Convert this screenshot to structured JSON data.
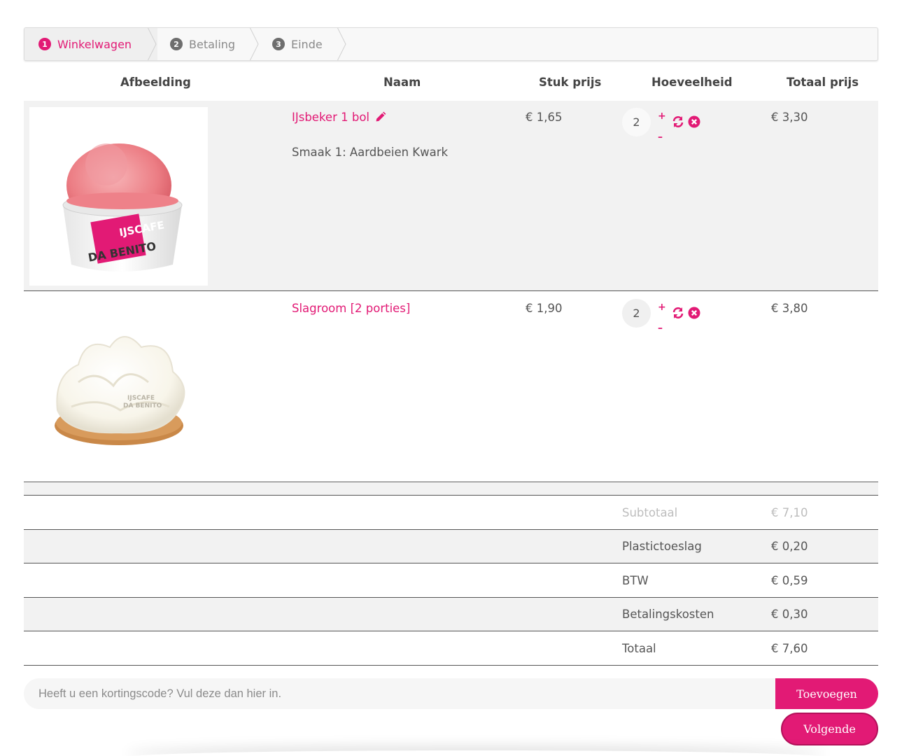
{
  "steps": [
    {
      "num": "1",
      "label": "Winkelwagen",
      "active": true
    },
    {
      "num": "2",
      "label": "Betaling",
      "active": false
    },
    {
      "num": "3",
      "label": "Einde",
      "active": false
    }
  ],
  "table": {
    "headers": {
      "image": "Afbeelding",
      "name": "Naam",
      "unit_price": "Stuk prijs",
      "quantity": "Hoeveelheid",
      "total_price": "Totaal prijs"
    },
    "rows": [
      {
        "name": "IJsbeker 1 bol",
        "option": "Smaak 1: Aardbeien Kwark",
        "unit_price": "€ 1,65",
        "quantity": "2",
        "total_price": "€ 3,30",
        "image_brand": "IJSCAFE DA BENITO"
      },
      {
        "name": "Slagroom [2 porties]",
        "option": "",
        "unit_price": "€ 1,90",
        "quantity": "2",
        "total_price": "€ 3,80",
        "image_brand": "IJSCAFE DA BENITO"
      }
    ],
    "plus_symbol": "+",
    "minus_symbol": "–"
  },
  "totals": [
    {
      "label": "Subtotaal",
      "value": "€ 7,10"
    },
    {
      "label": "Plastictoeslag",
      "value": "€ 0,20"
    },
    {
      "label": "BTW",
      "value": "€ 0,59"
    },
    {
      "label": "Betalingskosten",
      "value": "€ 0,30"
    },
    {
      "label": "Totaal",
      "value": "€ 7,60"
    }
  ],
  "coupon": {
    "placeholder": "Heeft u een kortingscode? Vul deze dan hier in.",
    "button": "Toevoegen"
  },
  "next_button": "Volgende",
  "colors": {
    "accent": "#e21a75",
    "row_grey": "#f2f2f2",
    "text": "#555555"
  },
  "icons": [
    "pencil-icon",
    "refresh-icon",
    "remove-icon"
  ]
}
